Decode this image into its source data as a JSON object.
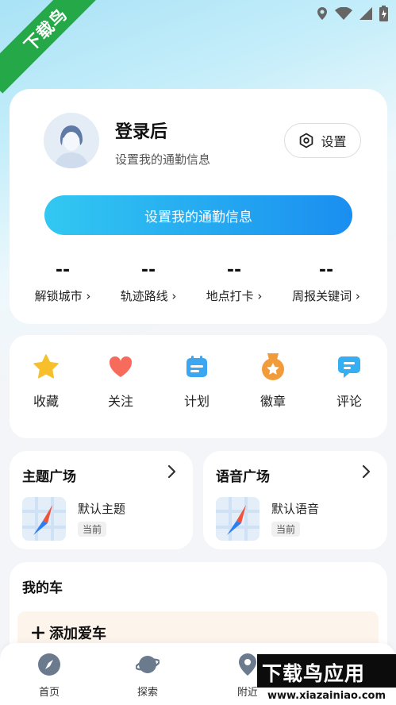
{
  "watermark": {
    "ribbon_text": "下载鸟",
    "brand": "下载鸟应用",
    "url": "www.xiazainiao.com"
  },
  "profile": {
    "name": "登录后",
    "subtitle": "设置我的通勤信息",
    "settings_label": "设置",
    "commute_button": "设置我的通勤信息",
    "stats": [
      {
        "value": "--",
        "label": "解锁城市 ›"
      },
      {
        "value": "--",
        "label": "轨迹路线 ›"
      },
      {
        "value": "--",
        "label": "地点打卡 ›"
      },
      {
        "value": "--",
        "label": "周报关键词 ›"
      }
    ]
  },
  "actions": [
    {
      "label": "收藏",
      "icon": "star-icon",
      "color": "#f7c02b"
    },
    {
      "label": "关注",
      "icon": "heart-icon",
      "color": "#f66b5c"
    },
    {
      "label": "计划",
      "icon": "calendar-icon",
      "color": "#3da6f0"
    },
    {
      "label": "徽章",
      "icon": "medal-icon",
      "color": "#f29b3a"
    },
    {
      "label": "评论",
      "icon": "comment-icon",
      "color": "#35aef2"
    }
  ],
  "theme_square": {
    "title": "主题广场",
    "item": "默认主题",
    "badge": "当前"
  },
  "voice_square": {
    "title": "语音广场",
    "item": "默认语音",
    "badge": "当前"
  },
  "my_car": {
    "title": "我的车",
    "add_label": "添加爱车"
  },
  "bottom_nav": [
    {
      "label": "首页",
      "icon": "compass-icon"
    },
    {
      "label": "探索",
      "icon": "planet-icon"
    },
    {
      "label": "附近",
      "icon": "location-icon"
    }
  ],
  "colors": {
    "accent_start": "#32c8f1",
    "accent_end": "#1a8ef0",
    "ribbon": "#25a848"
  }
}
